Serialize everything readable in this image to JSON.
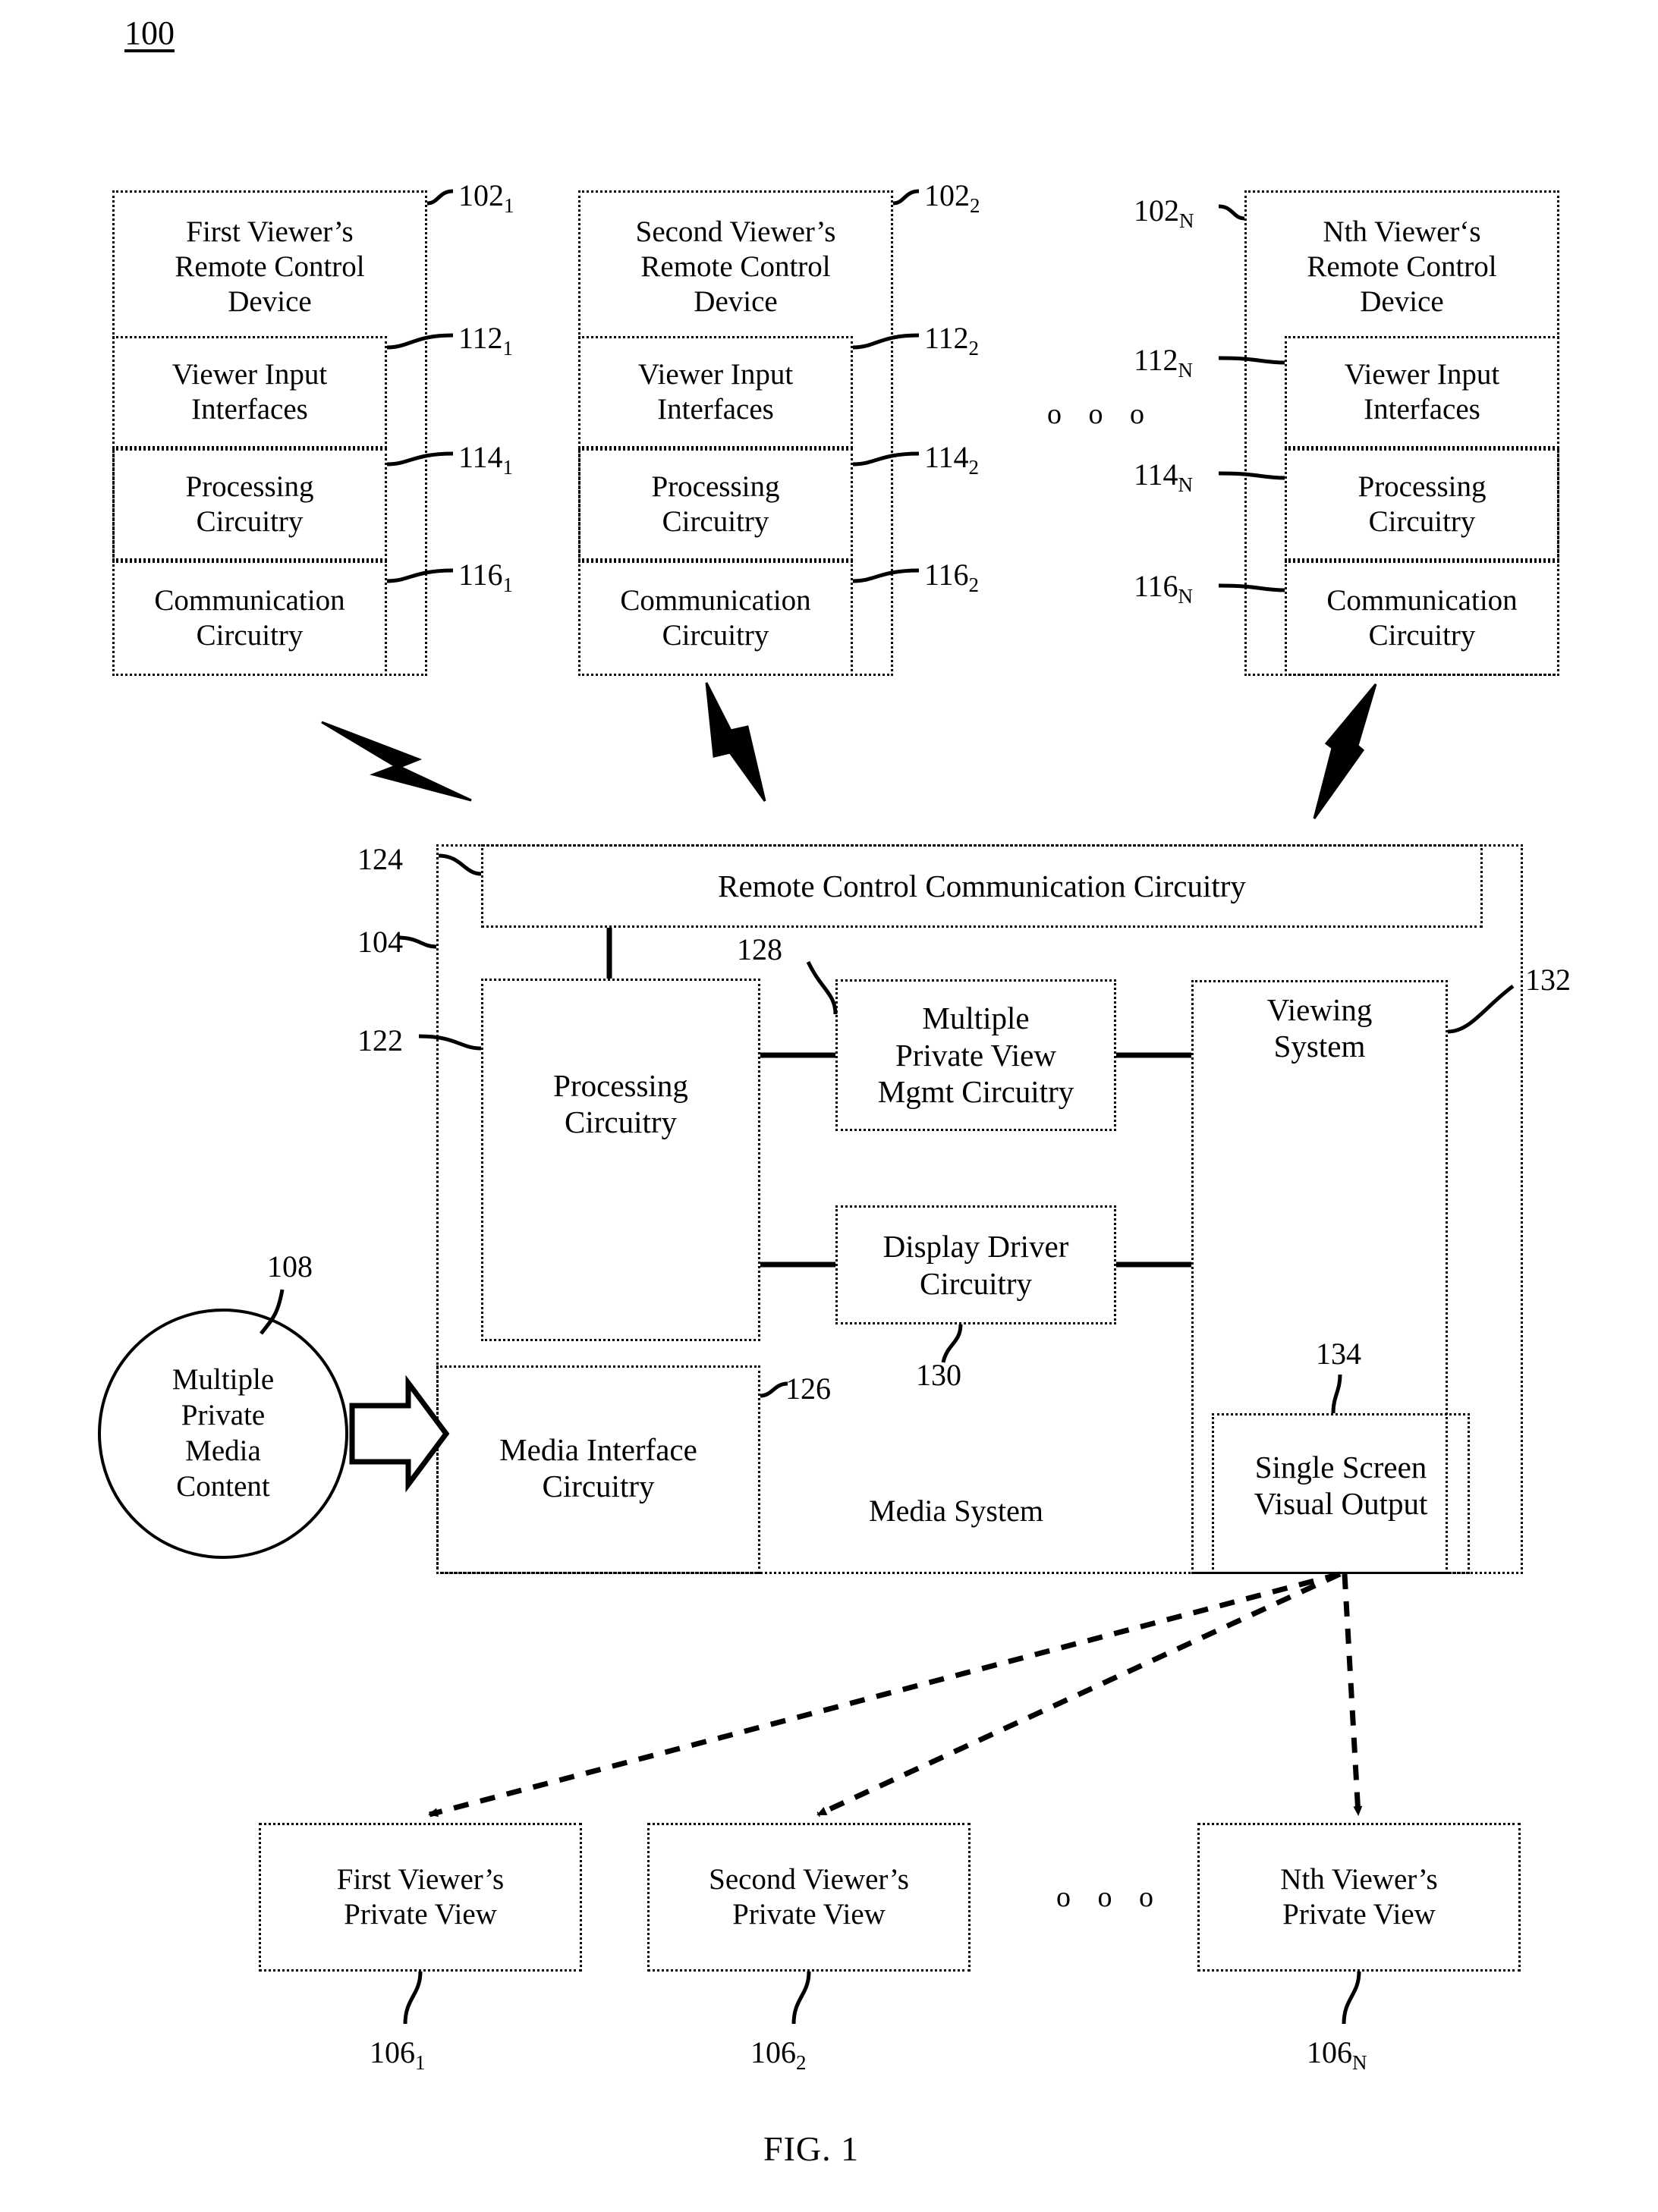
{
  "figure": {
    "number_label": "100",
    "caption": "FIG. 1",
    "ellipsis": "o o o"
  },
  "remote_devices": [
    {
      "title": "First Viewer’s\nRemote Control\nDevice",
      "ref": "102",
      "ref_sub": "1",
      "blocks": [
        {
          "label": "Viewer Input\nInterfaces",
          "ref": "112",
          "ref_sub": "1"
        },
        {
          "label": "Processing\nCircuitry",
          "ref": "114",
          "ref_sub": "1"
        },
        {
          "label": "Communication\nCircuitry",
          "ref": "116",
          "ref_sub": "1"
        }
      ]
    },
    {
      "title": "Second Viewer’s\nRemote Control\nDevice",
      "ref": "102",
      "ref_sub": "2",
      "blocks": [
        {
          "label": "Viewer Input\nInterfaces",
          "ref": "112",
          "ref_sub": "2"
        },
        {
          "label": "Processing\nCircuitry",
          "ref": "114",
          "ref_sub": "2"
        },
        {
          "label": "Communication\nCircuitry",
          "ref": "116",
          "ref_sub": "2"
        }
      ]
    },
    {
      "title": "Nth Viewer‘s\nRemote Control\nDevice",
      "ref": "102",
      "ref_sub": "N",
      "blocks": [
        {
          "label": "Viewer Input\nInterfaces",
          "ref": "112",
          "ref_sub": "N"
        },
        {
          "label": "Processing\nCircuitry",
          "ref": "114",
          "ref_sub": "N"
        },
        {
          "label": "Communication\nCircuitry",
          "ref": "116",
          "ref_sub": "N"
        }
      ]
    }
  ],
  "media_content": {
    "label": "Multiple\nPrivate\nMedia\nContent",
    "ref": "108"
  },
  "media_system": {
    "name": "Media System",
    "ref": "104",
    "remote_control_comm": {
      "label": "Remote Control Communication Circuitry",
      "ref": "124"
    },
    "processing": {
      "label": "Processing\nCircuitry",
      "ref": "122"
    },
    "mpv_mgmt": {
      "label": "Multiple\nPrivate View\nMgmt Circuitry",
      "ref": "128"
    },
    "display_driver": {
      "label": "Display Driver\nCircuitry",
      "ref": "130"
    },
    "media_interface": {
      "label": "Media Interface\nCircuitry",
      "ref": "126"
    },
    "viewing_system": {
      "label": "Viewing\nSystem",
      "ref": "132"
    },
    "single_screen": {
      "label": "Single Screen\nVisual Output",
      "ref": "134"
    }
  },
  "private_views": [
    {
      "label": "First Viewer’s\nPrivate View",
      "ref": "106",
      "ref_sub": "1"
    },
    {
      "label": "Second Viewer’s\nPrivate View",
      "ref": "106",
      "ref_sub": "2"
    },
    {
      "label": "Nth Viewer’s\nPrivate View",
      "ref": "106",
      "ref_sub": "N"
    }
  ]
}
